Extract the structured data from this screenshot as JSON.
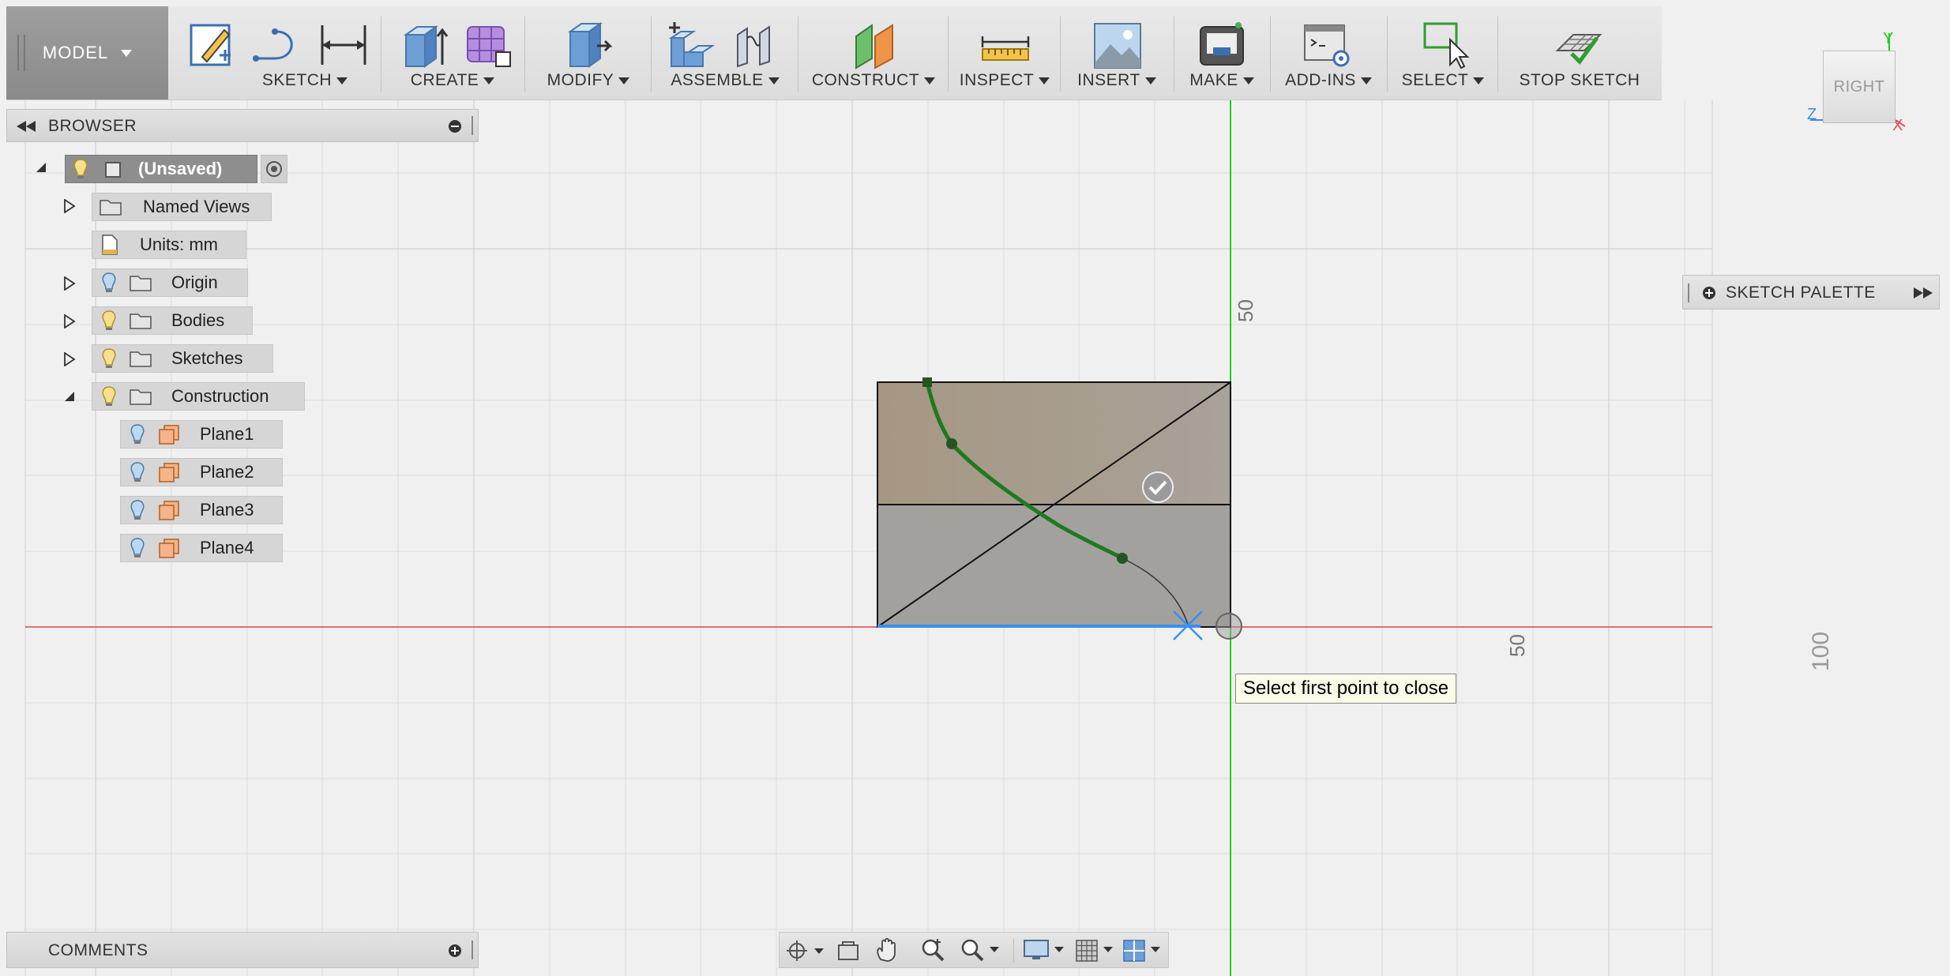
{
  "toolbar": {
    "model_label": "MODEL",
    "groups": {
      "sketch": "SKETCH",
      "create": "CREATE",
      "modify": "MODIFY",
      "assemble": "ASSEMBLE",
      "construct": "CONSTRUCT",
      "inspect": "INSPECT",
      "insert": "INSERT",
      "make": "MAKE",
      "addins": "ADD-INS",
      "select": "SELECT",
      "stop_sketch": "STOP SKETCH"
    }
  },
  "browser": {
    "title": "BROWSER",
    "items": [
      {
        "label": "(Unsaved)"
      },
      {
        "label": "Named Views"
      },
      {
        "label": "Units: mm"
      },
      {
        "label": "Origin"
      },
      {
        "label": "Bodies"
      },
      {
        "label": "Sketches"
      },
      {
        "label": "Construction"
      },
      {
        "label": "Plane1"
      },
      {
        "label": "Plane2"
      },
      {
        "label": "Plane3"
      },
      {
        "label": "Plane4"
      }
    ]
  },
  "comments": {
    "title": "COMMENTS"
  },
  "sketch_palette": {
    "title": "SKETCH PALETTE"
  },
  "tooltip": {
    "text": "Select first point to close"
  },
  "viewcube": {
    "face": "RIGHT",
    "axis_y": "Y",
    "axis_z": "Z",
    "axis_x": "X"
  },
  "rulers": {
    "v_50": "50",
    "h_50": "50",
    "side_100": "100"
  },
  "colors": {
    "x_axis": "#e06060",
    "y_axis": "#22cc22",
    "spline": "#1e7a1e",
    "profile_fill": "#a89a87",
    "accent_blue": "#3a8ef0"
  }
}
